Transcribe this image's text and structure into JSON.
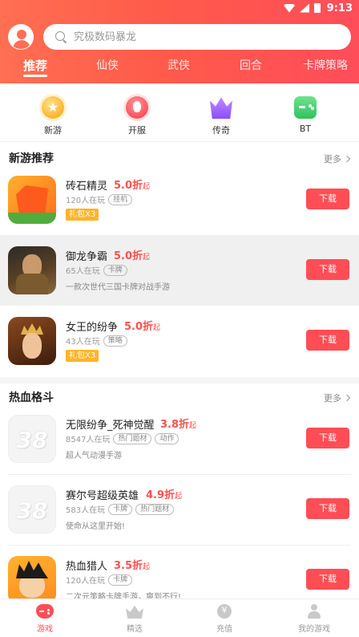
{
  "status": {
    "time": "9:13"
  },
  "search": {
    "placeholder": "究极数码暴龙"
  },
  "tabs": [
    "推荐",
    "仙侠",
    "武侠",
    "回合",
    "卡牌策略"
  ],
  "categories": [
    "新游",
    "开服",
    "传奇",
    "BT"
  ],
  "sections": {
    "new": {
      "title": "新游推荐",
      "more": "更多"
    },
    "hot": {
      "title": "热血格斗",
      "more": "更多"
    }
  },
  "items": [
    {
      "name": "砖石精灵",
      "discount": "5.0折",
      "suffix": "起",
      "players": "120人在玩",
      "tags": [
        "挂机"
      ],
      "gift": "礼包X3",
      "desc": "",
      "download": "下载"
    },
    {
      "name": "御龙争霸",
      "discount": "5.0折",
      "suffix": "起",
      "players": "65人在玩",
      "tags": [
        "卡牌"
      ],
      "gift": "",
      "desc": "一款次世代三国卡牌对战手游",
      "download": "下载"
    },
    {
      "name": "女王的纷争",
      "discount": "5.0折",
      "suffix": "起",
      "players": "43人在玩",
      "tags": [
        "策略"
      ],
      "gift": "礼包X3",
      "desc": "",
      "download": "下载"
    },
    {
      "name": "无限纷争_死神觉醒",
      "discount": "3.8折",
      "suffix": "起",
      "players": "8547人在玩",
      "tags": [
        "热门题材",
        "动作"
      ],
      "gift": "",
      "desc": "超人气动漫手游",
      "download": "下载"
    },
    {
      "name": "赛尔号超级英雄",
      "discount": "4.9折",
      "suffix": "起",
      "players": "583人在玩",
      "tags": [
        "卡牌",
        "热门题材"
      ],
      "gift": "",
      "desc": "使命从这里开始!",
      "download": "下载"
    },
    {
      "name": "热血猎人",
      "discount": "3.5折",
      "suffix": "起",
      "players": "120人在玩",
      "tags": [
        "卡牌"
      ],
      "gift": "",
      "desc": "二次元策略卡牌手游，爽到不行!",
      "download": "下载"
    }
  ],
  "thumb_text": {
    "placeholder": "38"
  },
  "bottom_nav": [
    "游戏",
    "精选",
    "充值",
    "我的游戏"
  ],
  "colors": {
    "accent": "#ff4d55",
    "header_start": "#ff6f52",
    "header_end": "#ff4d5a",
    "gift": "#ffb428"
  }
}
